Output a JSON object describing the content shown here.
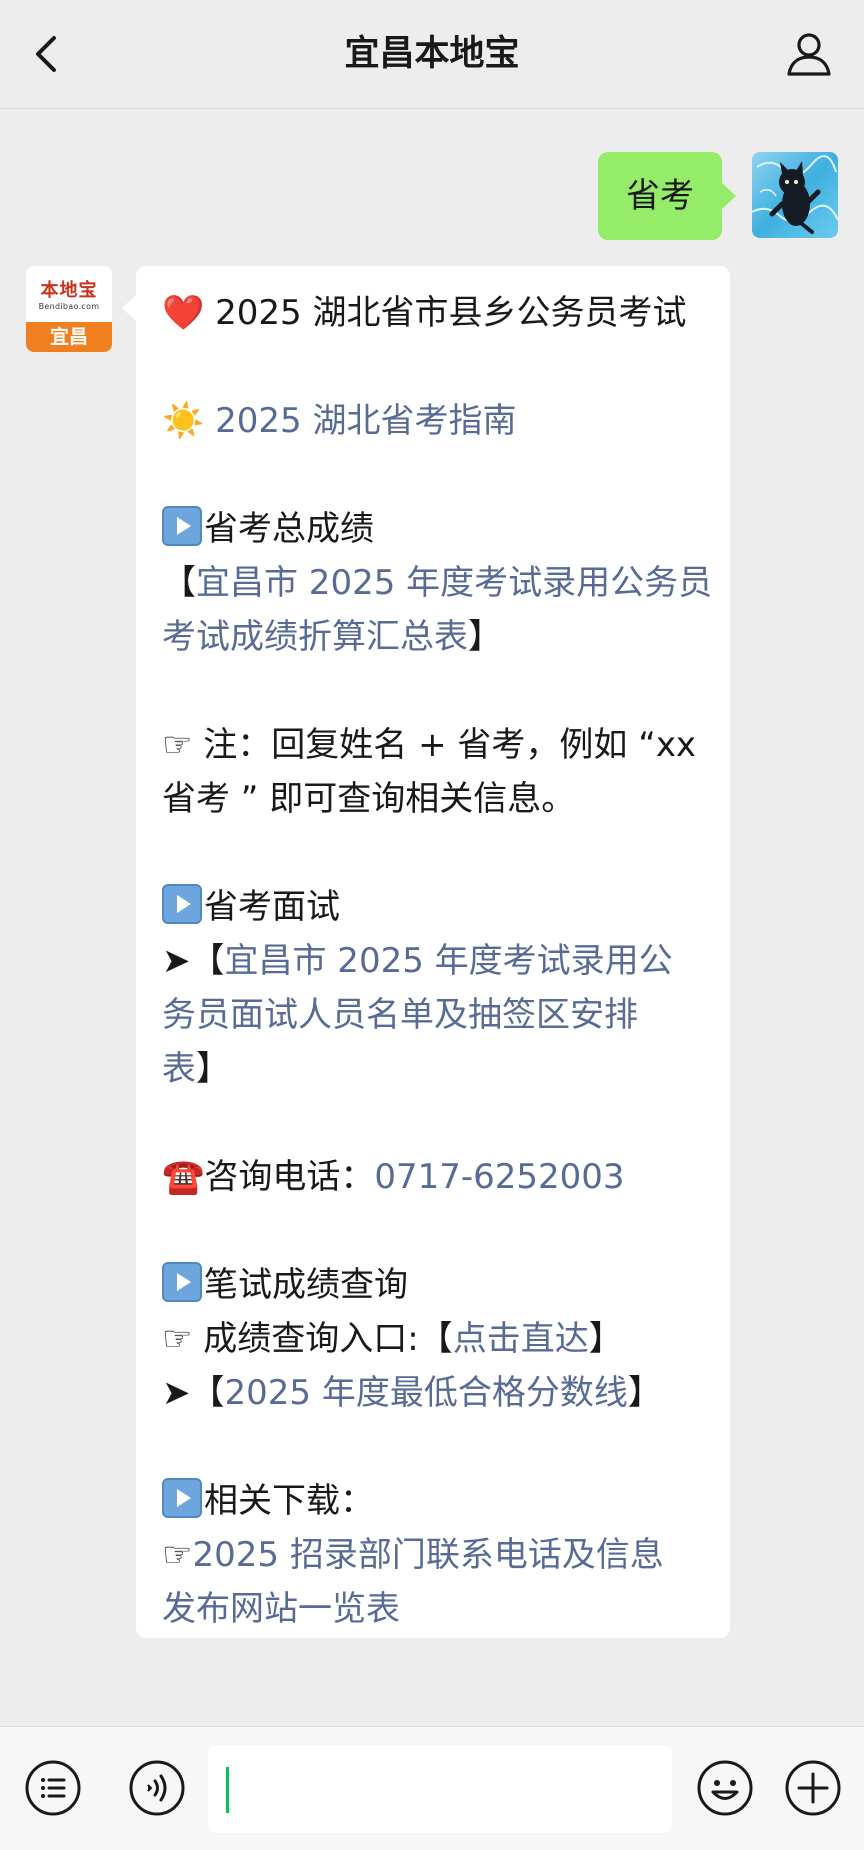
{
  "header": {
    "title": "宜昌本地宝"
  },
  "icons": {
    "back": "chevron-left-icon",
    "profile": "person-icon",
    "menu": "list-menu-icon",
    "voice": "voice-icon",
    "emoji": "emoji-icon",
    "plus": "plus-icon"
  },
  "colors": {
    "background": "#ededed",
    "my_bubble": "#95ec69",
    "link": "#576b95",
    "cursor": "#07c160"
  },
  "chat": {
    "my_message": "省考",
    "bot_avatar": {
      "logo_text": "本地宝",
      "logo_url": "Bendibao.com",
      "city": "宜昌"
    },
    "bot_message": {
      "line1_icon": "❤️",
      "line1_text": "2025 湖北省市县乡公务员考试",
      "line2_icon": "☀️",
      "line2_text": "2025 湖北省考指南",
      "sec1_title": "省考总成绩",
      "sec1_open": "【",
      "sec1_link_a": "宜昌市 2025 年度考试录用公务员",
      "sec1_link_b": "考试成绩折算汇总表",
      "sec1_close": "】",
      "note_a": "☞ 注：回复姓名 + 省考，例如 “xx",
      "note_b": "省考 ” 即可查询相关信息。",
      "sec2_title": "省考面试",
      "sec2_prefix": "➤【",
      "sec2_link_a": "宜昌市 2025 年度考试录用公",
      "sec2_link_b": "务员面试人员名单及抽签区安排",
      "sec2_link_c": "表",
      "sec2_close": "】",
      "phone_icon": "☎️",
      "phone_label": "咨询电话：",
      "phone_number": "0717-6252003",
      "sec3_title": "笔试成绩查询",
      "sec3_entry_label": "☞ 成绩查询入口:【",
      "sec3_entry_link": "点击直达",
      "sec3_entry_close": "】",
      "sec3_score_prefix": "➤【",
      "sec3_score_link": "2025 年度最低合格分数线",
      "sec3_score_close": "】",
      "sec4_title": "相关下载：",
      "sec4_prefix": "☞",
      "sec4_link_a": "2025 招录部门联系电话及信息",
      "sec4_link_b": "发布网站一览表"
    }
  },
  "input": {
    "value": ""
  }
}
